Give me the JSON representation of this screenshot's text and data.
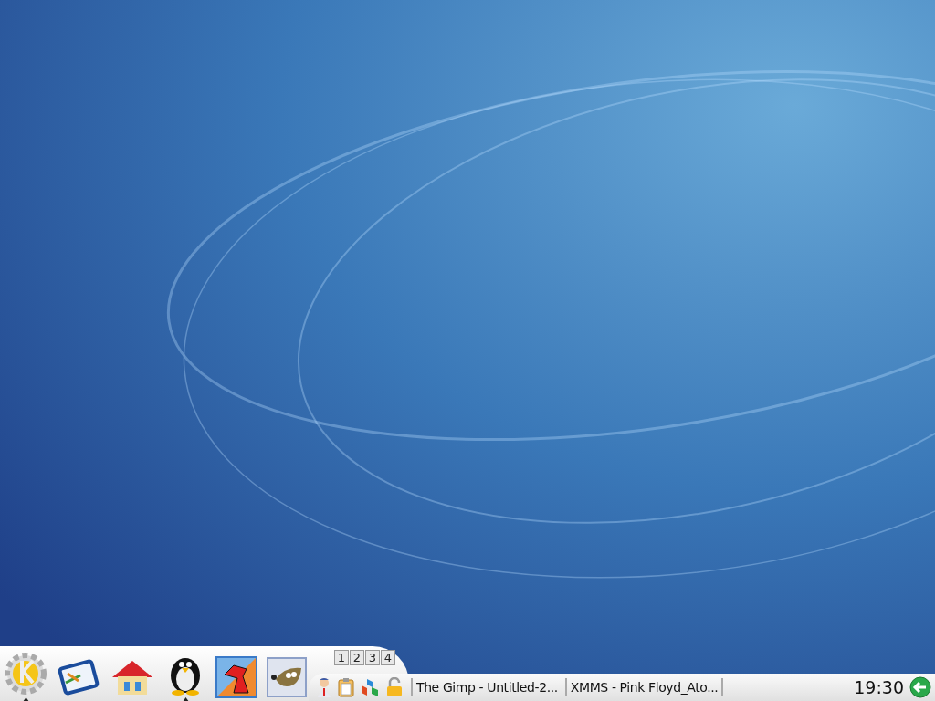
{
  "pager": {
    "desktops": [
      "1",
      "2",
      "3",
      "4"
    ]
  },
  "taskbar": {
    "tasks": [
      {
        "title": "The Gimp - Untitled-2..."
      },
      {
        "title": "XMMS - Pink Floyd_Ato..."
      }
    ]
  },
  "clock": {
    "time": "19:30"
  }
}
